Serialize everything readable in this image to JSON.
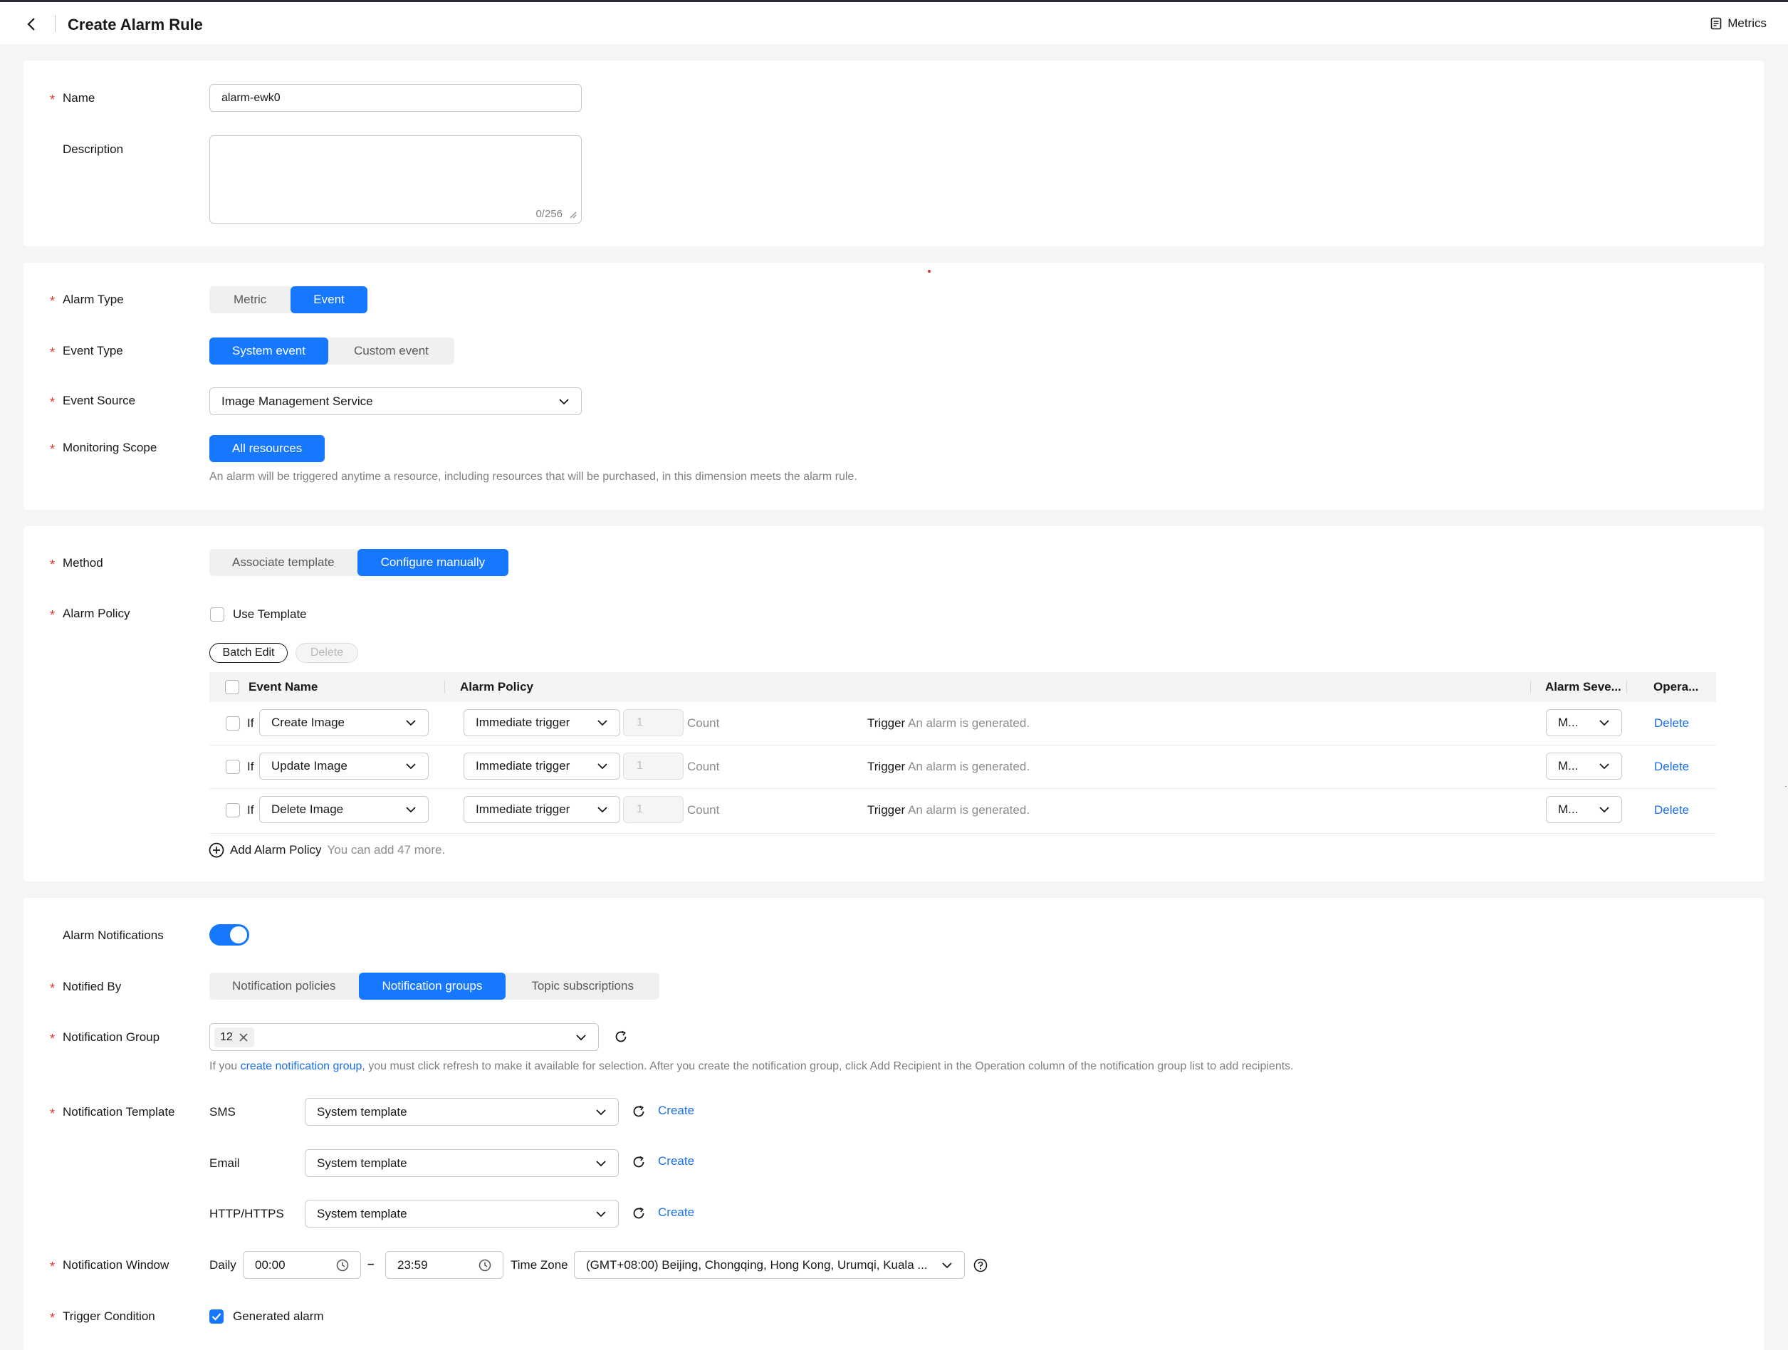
{
  "header": {
    "title": "Create Alarm Rule",
    "metrics_label": "Metrics"
  },
  "basic": {
    "name_label": "Name",
    "name_value": "alarm-ewk0",
    "description_label": "Description",
    "description_counter": "0/256"
  },
  "alarm_settings": {
    "alarm_type_label": "Alarm Type",
    "alarm_type_options": [
      "Metric",
      "Event"
    ],
    "event_type_label": "Event Type",
    "event_type_options": [
      "System event",
      "Custom event"
    ],
    "event_source_label": "Event Source",
    "event_source_value": "Image Management Service",
    "monitoring_scope_label": "Monitoring Scope",
    "monitoring_scope_value": "All resources",
    "monitoring_scope_hint": "An alarm will be triggered anytime a resource, including resources that will be purchased, in this dimension meets the alarm rule."
  },
  "policy": {
    "method_label": "Method",
    "method_options": [
      "Associate template",
      "Configure manually"
    ],
    "alarm_policy_label": "Alarm Policy",
    "use_template_label": "Use Template",
    "batch_edit_label": "Batch Edit",
    "delete_label": "Delete",
    "table_headers": {
      "event_name": "Event Name",
      "alarm_policy": "Alarm Policy",
      "severity": "Alarm Seve...",
      "operation": "Opera..."
    },
    "rows": [
      {
        "if": "If",
        "event": "Create Image",
        "trigger": "Immediate trigger",
        "count_value": "1",
        "count_unit": "Count",
        "trigger_word": "Trigger",
        "trigger_result": "An alarm is generated.",
        "severity": "M...",
        "action": "Delete"
      },
      {
        "if": "If",
        "event": "Update Image",
        "trigger": "Immediate trigger",
        "count_value": "1",
        "count_unit": "Count",
        "trigger_word": "Trigger",
        "trigger_result": "An alarm is generated.",
        "severity": "M...",
        "action": "Delete"
      },
      {
        "if": "If",
        "event": "Delete Image",
        "trigger": "Immediate trigger",
        "count_value": "1",
        "count_unit": "Count",
        "trigger_word": "Trigger",
        "trigger_result": "An alarm is generated.",
        "severity": "M...",
        "action": "Delete"
      }
    ],
    "add_policy_label": "Add Alarm Policy",
    "add_policy_hint": "You can add 47 more."
  },
  "notifications": {
    "alarm_notifications_label": "Alarm Notifications",
    "notified_by_label": "Notified By",
    "notified_by_options": [
      "Notification policies",
      "Notification groups",
      "Topic subscriptions"
    ],
    "notification_group_label": "Notification Group",
    "notification_group_tag": "12",
    "group_hint_prefix": "If you",
    "group_hint_link": "create notification group",
    "group_hint_suffix": ", you must click refresh to make it available for selection. After you create the notification group, click Add Recipient in the Operation column of the notification group list to add recipients.",
    "notification_template_label": "Notification Template",
    "templates": [
      {
        "channel": "SMS",
        "value": "System template",
        "create": "Create"
      },
      {
        "channel": "Email",
        "value": "System template",
        "create": "Create"
      },
      {
        "channel": "HTTP/HTTPS",
        "value": "System template",
        "create": "Create"
      }
    ],
    "notification_window_label": "Notification Window",
    "daily_label": "Daily",
    "start_time": "00:00",
    "range_dash": "–",
    "end_time": "23:59",
    "timezone_label": "Time Zone",
    "timezone_value": "(GMT+08:00) Beijing, Chongqing, Hong Kong, Urumqi, Kuala ...",
    "trigger_condition_label": "Trigger Condition",
    "trigger_condition_value": "Generated alarm"
  },
  "colors": {
    "primary": "#1677ff",
    "required": "#e6322b",
    "link": "#1a6ee6"
  }
}
